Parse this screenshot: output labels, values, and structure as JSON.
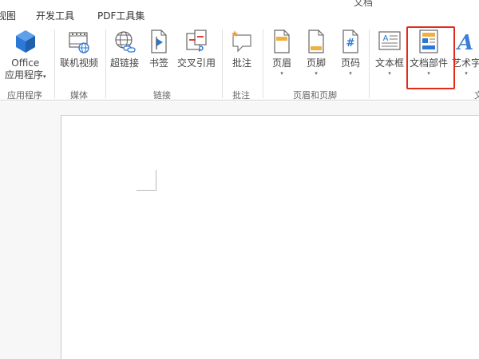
{
  "title_fragment": "文档",
  "tabs": [
    "视图",
    "开发工具",
    "PDF工具集"
  ],
  "ribbon": {
    "buttons": {
      "office_apps_line1": "Office",
      "office_apps_line2": "应用程序",
      "online_video": "联机视频",
      "hyperlink": "超链接",
      "bookmark": "书签",
      "cross_reference": "交叉引用",
      "comment": "批注",
      "header": "页眉",
      "footer": "页脚",
      "page_number": "页码",
      "text_box": "文本框",
      "quick_parts": "文档部件",
      "wordart": "艺术字"
    },
    "groups": {
      "apps": "应用程序",
      "media": "媒体",
      "links": "链接",
      "comments": "批注",
      "header_footer": "页眉和页脚",
      "text": "文"
    },
    "dropdown_arrow": "▾"
  },
  "colors": {
    "highlight": "#e32b1c",
    "office_blue": "#2b78d6",
    "accent_orange": "#f0a030"
  }
}
